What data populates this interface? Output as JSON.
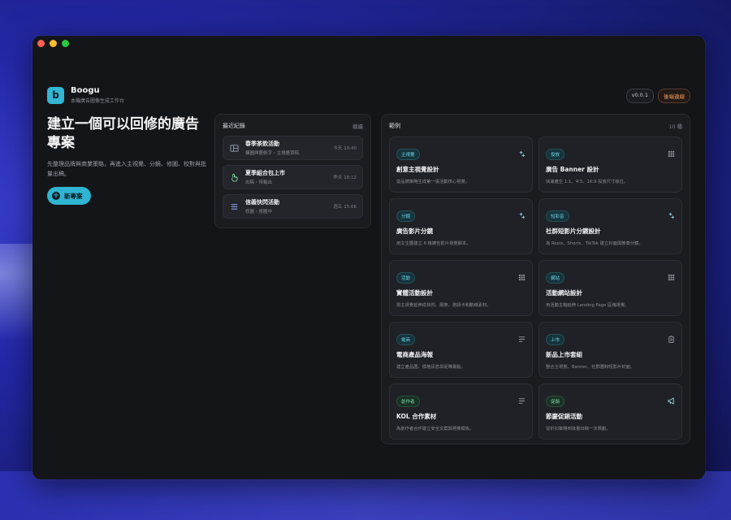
{
  "app": {
    "name": "Boogu",
    "subtitle": "本機廣告圖像生成工作台",
    "logo_letter": "b",
    "version": "v0.0.1",
    "settings_label": "後端連線"
  },
  "hero": {
    "title": "建立一個可以回修的廣告專案",
    "description": "先整理品牌與商業策略，再進入主視覺、分鏡、修圖、校對與批量出稿。",
    "new_button": "新專案"
  },
  "recent": {
    "title": "最近紀錄",
    "action": "繼續",
    "items": [
      {
        "title": "春季茶飲活動",
        "sub": "構圖與藝術字・主視覺草稿",
        "time": "今天 10:40",
        "icon": "layout-icon"
      },
      {
        "title": "夏季組合包上市",
        "sub": "出稿・待輸出",
        "time": "昨天 18:12",
        "icon": "hand-icon"
      },
      {
        "title": "信義快閃活動",
        "sub": "修圖・修圖中",
        "time": "週五 15:06",
        "icon": "list-icon"
      }
    ]
  },
  "examples": {
    "title": "範例",
    "count": "10 種",
    "cards": [
      {
        "tag": "主視覺",
        "tag_color": "blue",
        "title": "創意主視覺設計",
        "desc": "從品牌策略生成第一張活動核心視覺。",
        "icon": "sparkle-icon"
      },
      {
        "tag": "投放",
        "tag_color": "blue",
        "title": "廣告 Banner 設計",
        "desc": "快速產生 1:1、4:5、16:9 投放尺寸版位。",
        "icon": "grid-icon"
      },
      {
        "tag": "分鏡",
        "tag_color": "blue",
        "title": "廣告影片分鏡",
        "desc": "用文生圖建立 6 格廣告影片視覺腳本。",
        "icon": "sparkle-icon"
      },
      {
        "tag": "短影音",
        "tag_color": "blue",
        "title": "社群短影片分鏡設計",
        "desc": "為 Reels、Shorts、TikTok 建立封面與節奏分鏡。",
        "icon": "sparkle-icon"
      },
      {
        "tag": "活動",
        "tag_color": "blue",
        "title": "實體活動設計",
        "desc": "把主視覺延伸成快閃、展架、邀請卡和動線素材。",
        "icon": "grid-icon"
      },
      {
        "tag": "網站",
        "tag_color": "blue",
        "title": "活動網站設計",
        "desc": "用活動主軸延伸 Landing Page 區塊視覺。",
        "icon": "grid-icon"
      },
      {
        "tag": "電商",
        "tag_color": "blue",
        "title": "電商產品海報",
        "desc": "建立產品圖、價格訊息與促購賣點。",
        "icon": "lines-icon"
      },
      {
        "tag": "上市",
        "tag_color": "blue",
        "title": "新品上市套組",
        "desc": "整合主視覺、Banner、社群圖和短影片封面。",
        "icon": "clipboard-icon"
      },
      {
        "tag": "創作者",
        "tag_color": "green",
        "title": "KOL 合作素材",
        "desc": "為創作者合作建立安全文案與視覺模板。",
        "icon": "lines-icon"
      },
      {
        "tag": "促銷",
        "tag_color": "green",
        "title": "節慶促銷活動",
        "desc": "從折扣策略到批量出稿一次規劃。",
        "icon": "megaphone-icon"
      }
    ]
  },
  "colors": {
    "accent": "#2fb4d2",
    "background": "#141518",
    "panel": "#1b1c20"
  }
}
